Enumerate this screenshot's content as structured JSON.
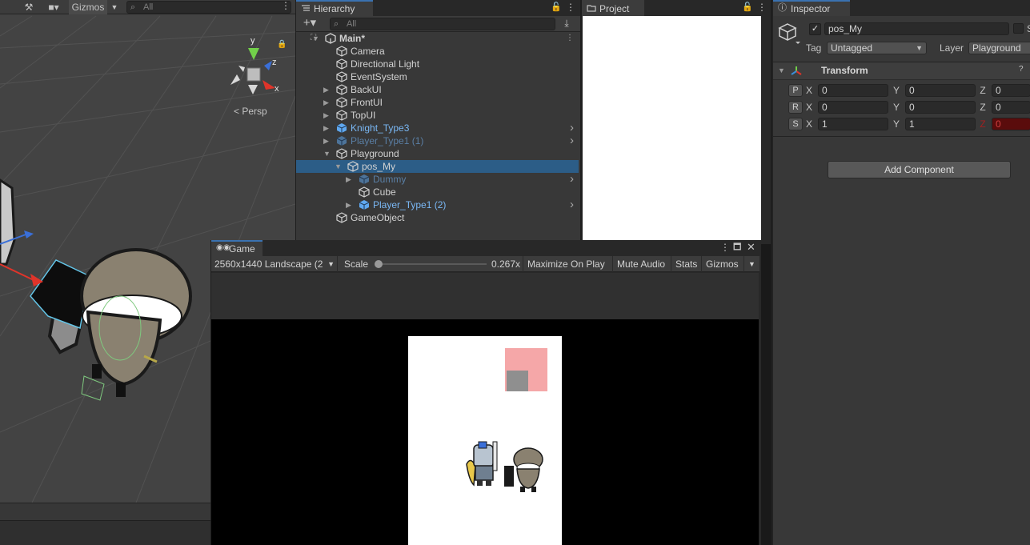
{
  "scene": {
    "gizmos_label": "Gizmos",
    "search_placeholder": "All",
    "persp_label": "< Persp",
    "axis_labels": {
      "y": "y",
      "z": "z",
      "x": "x"
    }
  },
  "hierarchy": {
    "tab_label": "Hierarchy",
    "search_placeholder": "All",
    "rows": [
      {
        "label": "Main*",
        "style": "root"
      },
      {
        "label": "Camera",
        "style": "normal"
      },
      {
        "label": "Directional Light",
        "style": "normal"
      },
      {
        "label": "EventSystem",
        "style": "normal"
      },
      {
        "label": "BackUI",
        "style": "normal"
      },
      {
        "label": "FrontUI",
        "style": "normal"
      },
      {
        "label": "TopUI",
        "style": "normal"
      },
      {
        "label": "Knight_Type3",
        "style": "prefab"
      },
      {
        "label": "Player_Type1 (1)",
        "style": "prefab-dim"
      },
      {
        "label": "Playground",
        "style": "normal"
      },
      {
        "label": "pos_My",
        "style": "selected"
      },
      {
        "label": "Dummy",
        "style": "prefab-dim"
      },
      {
        "label": "Cube",
        "style": "normal"
      },
      {
        "label": "Player_Type1 (2)",
        "style": "prefab"
      },
      {
        "label": "GameObject",
        "style": "normal"
      }
    ]
  },
  "project": {
    "tab_label": "Project"
  },
  "inspector": {
    "tab_label": "Inspector",
    "object_name": "pos_My",
    "static_label": "S",
    "tag_label": "Tag",
    "tag_value": "Untagged",
    "layer_label": "Layer",
    "layer_value": "Playground",
    "component_title": "Transform",
    "position": {
      "label": "P",
      "x": "0",
      "y": "0",
      "z": "0"
    },
    "rotation": {
      "label": "R",
      "x": "0",
      "y": "0",
      "z": "0"
    },
    "scale": {
      "label": "S",
      "x": "1",
      "y": "1",
      "z": "0"
    },
    "axis": {
      "x": "X",
      "y": "Y",
      "z": "Z"
    },
    "add_component_label": "Add Component"
  },
  "game": {
    "tab_label": "Game",
    "resolution": "2560x1440 Landscape (2",
    "scale_label": "Scale",
    "scale_value": "0.267x",
    "maximize_label": "Maximize On Play",
    "mute_label": "Mute Audio",
    "stats_label": "Stats",
    "gizmos_label": "Gizmos"
  },
  "colors": {
    "prefab_text": "#7ab8f5",
    "selection": "#2c5d87",
    "pink_square": "#f5a7a8",
    "z_scale_error": "#8a0e0e"
  }
}
